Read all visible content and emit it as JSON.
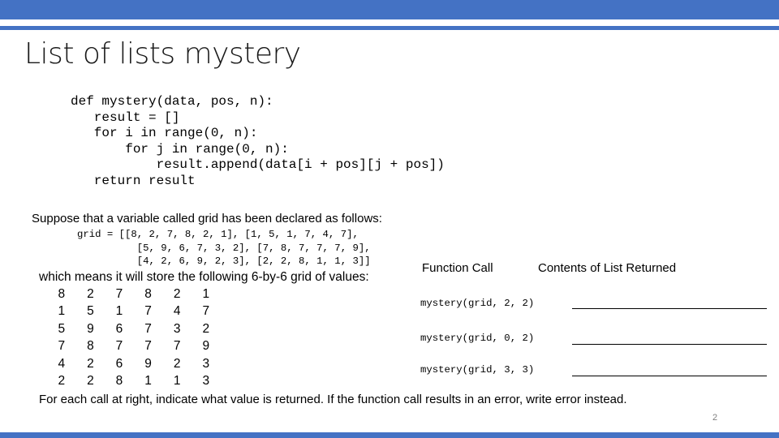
{
  "slide": {
    "title": "List of lists mystery",
    "code": "def mystery(data, pos, n):\n   result = []\n   for i in range(0, n):\n       for j in range(0, n):\n           result.append(data[i + pos][j + pos])\n   return result",
    "intro": "Suppose that a variable called grid has been declared as follows:",
    "declaration": "grid = [[8, 2, 7, 8, 2, 1], [1, 5, 1, 7, 4, 7],\n          [5, 9, 6, 7, 3, 2], [7, 8, 7, 7, 7, 9],\n          [4, 2, 6, 9, 2, 3], [2, 2, 8, 1, 1, 3]]",
    "means": "which means it will store the following 6-by-6 grid of values:",
    "grid_rows": [
      [
        "8",
        "2",
        "7",
        "8",
        "2",
        "1"
      ],
      [
        "1",
        "5",
        "1",
        "7",
        "4",
        "7"
      ],
      [
        "5",
        "9",
        "6",
        "7",
        "3",
        "2"
      ],
      [
        "7",
        "8",
        "7",
        "7",
        "7",
        "9"
      ],
      [
        "4",
        "2",
        "6",
        "9",
        "2",
        "3"
      ],
      [
        "2",
        "2",
        "8",
        "1",
        "1",
        "3"
      ]
    ],
    "table_headers": {
      "call": "Function Call",
      "contents": "Contents of List Returned"
    },
    "calls": [
      "mystery(grid, 2, 2)",
      "mystery(grid, 0, 2)",
      "mystery(grid, 3, 3)"
    ],
    "footer": "For each call at right, indicate what value is returned.  If the function call results in an error, write error instead.",
    "page_number": "2"
  },
  "colors": {
    "accent": "#4472c4",
    "page_number": "#7f7f7f"
  }
}
